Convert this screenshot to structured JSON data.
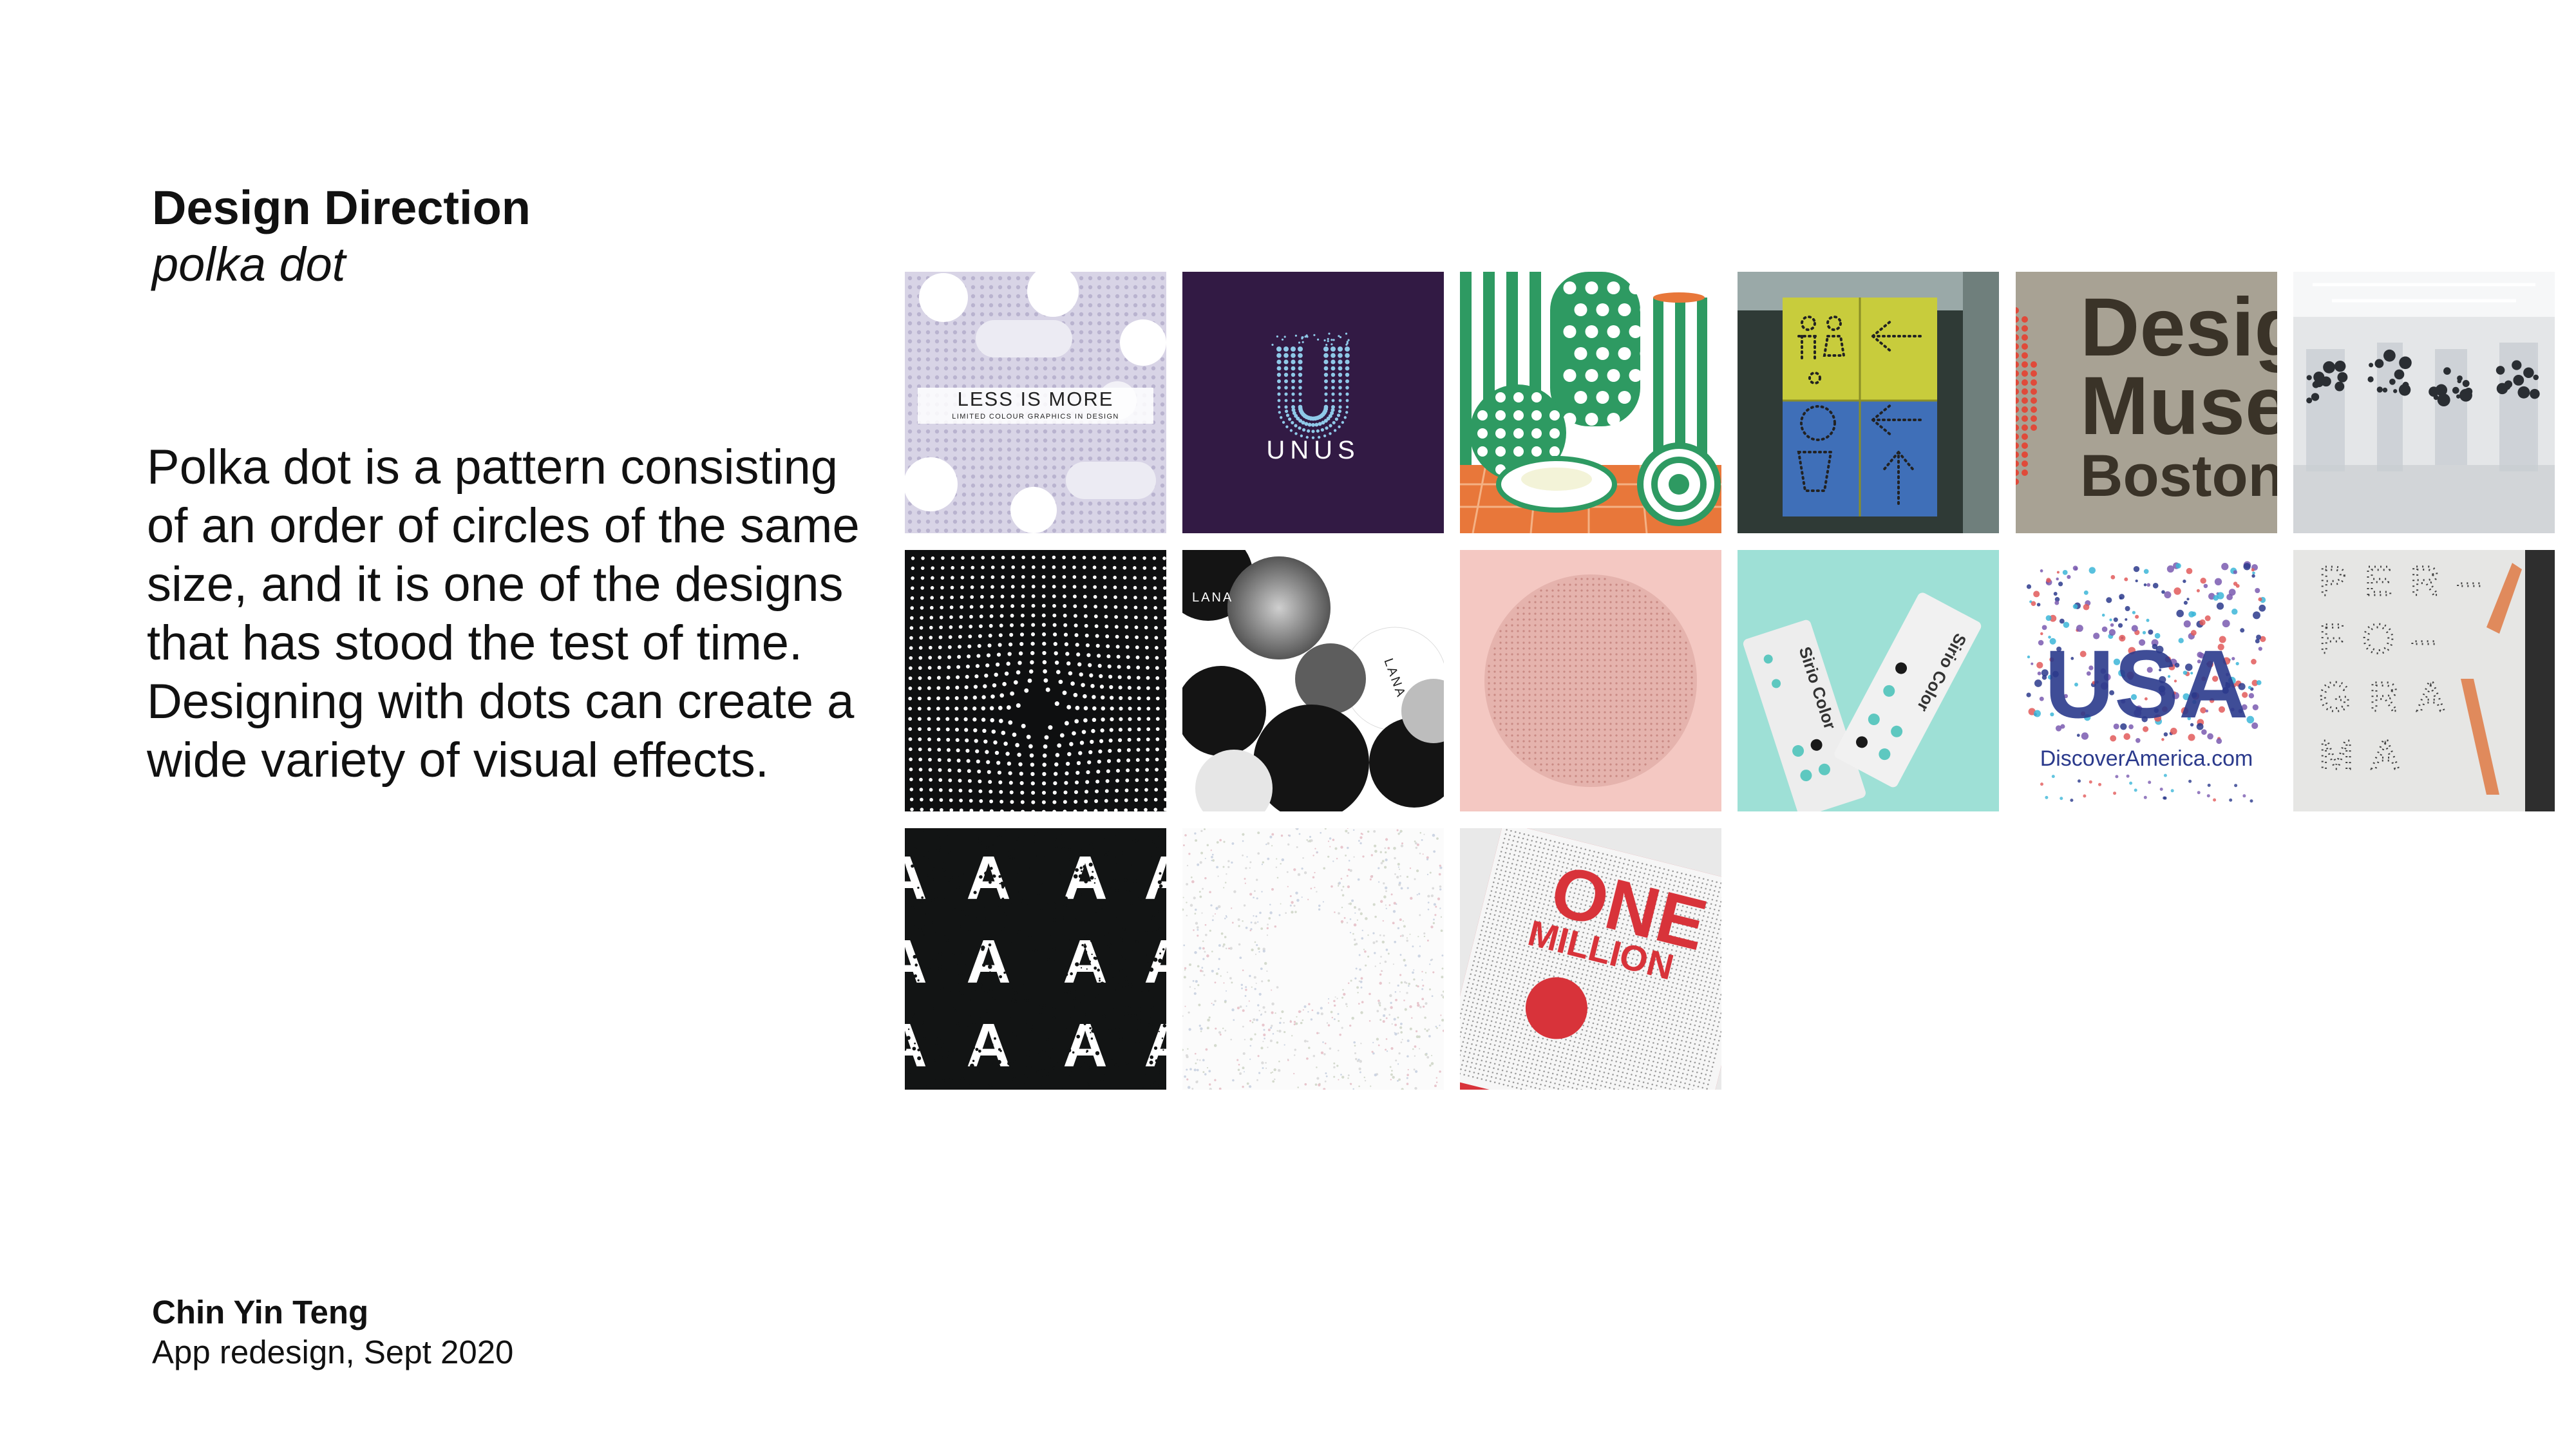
{
  "header": {
    "title": "Design Direction",
    "subtitle": "polka dot"
  },
  "description": "Polka dot is a pattern consisting of an order of circles of the same size, and it is one of the designs that has stood the test of time. Designing with dots can create a wide variety of visual effects.",
  "footer": {
    "author": "Chin Yin Teng",
    "project": "App redesign, Sept 2020"
  },
  "gallery": {
    "less_is_more": {
      "title": "LESS IS MORE",
      "subtitle": "LIMITED COLOUR GRAPHICS IN DESIGN"
    },
    "unus": {
      "title": "UNUS"
    },
    "design_museum": {
      "line1": "Desig",
      "line2": "Muse",
      "line3": "Boston"
    },
    "sirio": {
      "label1": "Sirio Color",
      "label2": "Sirio Color"
    },
    "usa": {
      "title": "USA",
      "site": "DiscoverAmerica.com"
    },
    "perfograma": {
      "row1": "PER–",
      "row2": "FO–",
      "row3": "GRA",
      "row4": "MA"
    },
    "lana": {
      "label1": "LANA",
      "label2": "LANA"
    },
    "letter_a": {
      "glyph": "A"
    },
    "one_million": {
      "line1": "ONE",
      "line2": "MILLION"
    }
  },
  "colors": {
    "unus_bg": "#321a44",
    "green": "#2e9a62",
    "orange": "#e8773a",
    "pink": "#f4c8c2",
    "mint": "#9ee0d6",
    "museum_bg": "#a8a294",
    "museum_red": "#e04a3a",
    "sign_yellow": "#c8cc3c",
    "sign_blue": "#3f6fb8",
    "usa_navy": "#2b3a8c",
    "usa_sky": "#3cb6d8",
    "one_red": "#d8333a"
  }
}
